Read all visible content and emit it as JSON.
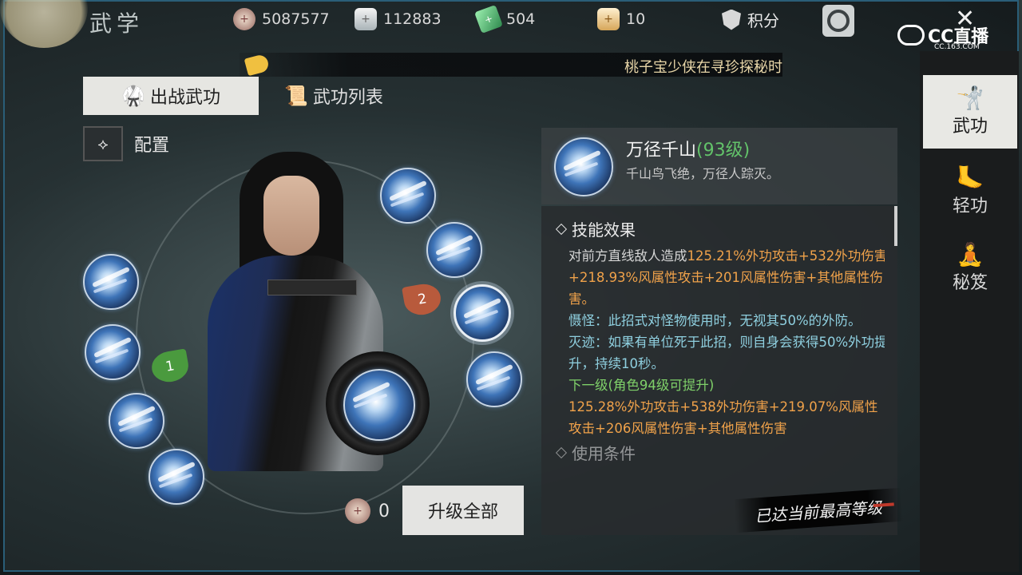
{
  "header": {
    "title": "武学",
    "currencies": [
      {
        "icon": "coin-icon",
        "value": "5087577"
      },
      {
        "icon": "silver-ingot-icon",
        "value": "112883"
      },
      {
        "icon": "jade-icon",
        "value": "504"
      },
      {
        "icon": "gold-ingot-icon",
        "value": "10"
      }
    ],
    "points_label": "积分",
    "logo_text": "CC直播",
    "logo_sub": "CC.163.COM"
  },
  "banner": {
    "message": "桃子宝少侠在寻珍探秘时"
  },
  "tabs": {
    "active": "出战武功",
    "inactive": "武功列表"
  },
  "config_label": "配置",
  "slot_badges": {
    "left": "1",
    "right": "2"
  },
  "upgrade": {
    "cost": "0",
    "button_label": "升级全部"
  },
  "skill": {
    "name": "万径千山",
    "level": "(93级)",
    "flavor": "千山鸟飞绝，万径人踪灭。",
    "effects_title": "技能效果",
    "effect_line1_plain": "对前方直线敌人造成",
    "effect_line1_hl": "125.21%外功攻击+",
    "effect_line2": "532外功伤害+218.93%风属性攻击+201风属性伤害+其他属性伤害。",
    "shekuai": "慑怪：此招式对怪物使用时，无视其50%的外防。",
    "mieji": "灭迹：如果有单位死于此招，则自身会获得50%外功提升，持续10秒。",
    "next_level": "下一级(角色94级可提升)",
    "next_effect": "125.28%外功攻击+538外功伤害+219.07%风属性攻击+206风属性伤害+其他属性伤害",
    "usage_title": "使用条件",
    "max_level": "已达当前最高等级"
  },
  "sidenav": [
    {
      "label": "武功",
      "icon": "martial-arts-icon",
      "active": true
    },
    {
      "label": "轻功",
      "icon": "light-skill-icon",
      "active": false
    },
    {
      "label": "秘笈",
      "icon": "secret-manual-icon",
      "active": false
    }
  ],
  "colors": {
    "highlight_orange": "#f0a24a",
    "effect_teal": "#8fd0e0",
    "level_green": "#63c36a",
    "frame_blue": "#2a5e78"
  }
}
